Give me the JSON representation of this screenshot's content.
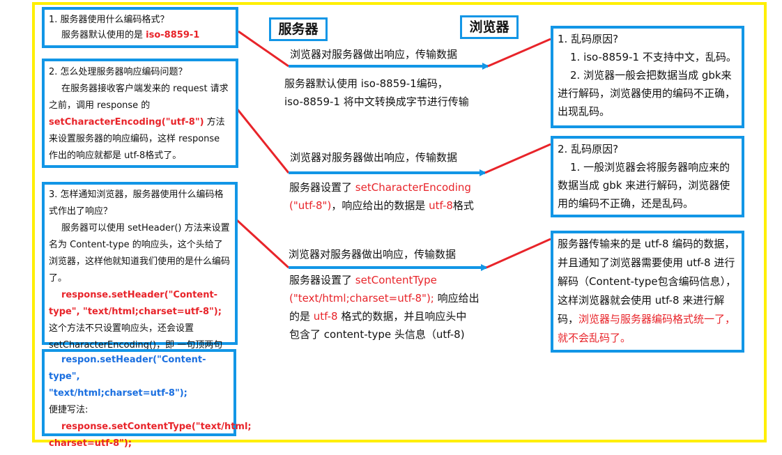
{
  "headers": {
    "server": "服务器",
    "browser": "浏览器"
  },
  "left": {
    "box1": {
      "q": "1. 服务器使用什么编码格式？",
      "a_prefix": "服务器默认使用的是",
      "a_value": "iso-8859-1"
    },
    "box2": {
      "q": "2. 怎么处理服务器响应编码问题？",
      "p1": "在服务器接收客户端发来的 request 请求之前，调用 response 的",
      "method": "setCharacterEncoding(\"utf-8\")",
      "p2": "方法来设置服务器的响应编码，这样 response 作出的响应就都是 utf-8格式了。"
    },
    "box3": {
      "q": "3. 怎样通知浏览器，服务器使用什么编码格式作出了响应？",
      "p1": "服务器可以使用 setHeader() 方法来设置名为 Content-type 的响应头，这个头给了浏览器，这样他就知道我们使用的是什么编码了。",
      "code": "response.setHeader(\"Content-type\", \"text/html;charset=utf-8\");",
      "p2": "这个方法不只设置响应头，还会设置 setCharacterEncoding()，即 一句顶两句用。"
    },
    "box4": {
      "code1a": "respon.setHeader(\"Content-type\",",
      "code1b": "\"text/html;charset=utf-8\");",
      "shortcut": "便捷写法:",
      "code2a": "response.setContentType(\"text/html;",
      "code2b": "charset=utf-8\");"
    }
  },
  "center": {
    "row1": {
      "arrow_label": "浏览器对服务器做出响应，传输数据",
      "l1": "服务器默认使用 iso-8859-1编码，",
      "l2": "iso-8859-1 将中文转换成字节进行传输"
    },
    "row2": {
      "arrow_label": "浏览器对服务器做出响应，传输数据",
      "l1_prefix": "服务器设置了",
      "l1_red": "setCharacterEncoding",
      "l2_red": "(\"utf-8\")",
      "l2_mid": "，响应给出的数据是",
      "l2_red2": "utf-8",
      "l2_suffix": "格式"
    },
    "row3": {
      "arrow_label": "浏览器对服务器做出响应，传输数据",
      "l1_prefix": "服务器设置了",
      "l1_red": "setContentType",
      "l2_red": "(\"text/html;charset=utf-8\");",
      "l2_suffix": "响应给出",
      "l3_prefix": "的是",
      "l3_red": "utf-8",
      "l3_suffix": "格式的数据，并且响应头中",
      "l4": "包含了 content-type 头信息（utf-8)"
    }
  },
  "right": {
    "box1": {
      "title": "1. 乱码原因?",
      "p1": "1. iso-8859-1 不支持中文，乱码。",
      "p2": "2. 浏览器一般会把数据当成 gbk来进行解码，浏览器使用的编码不正确，出现乱码。"
    },
    "box2": {
      "title": "2. 乱码原因?",
      "p1": "1. 一般浏览器会将服务器响应来的数据当成 gbk 来进行解码，浏览器使用的编码不正确，还是乱码。"
    },
    "box3": {
      "p1": "服务器传输来的是 utf-8 编码的数据，并且通知了浏览器需要使用 utf-8 进行解码（Content-type包含编码信息），这样浏览器就会使用 utf-8 来进行解码，",
      "p1_red": "浏览器与服务器编码格式统一了，就不会乱码了。"
    }
  },
  "colors": {
    "frame": "#ffef00",
    "box_border": "#1296e6",
    "arrow_blue": "#1296e6",
    "line_red": "#e8242a",
    "emphasis_red": "#e8242a"
  }
}
